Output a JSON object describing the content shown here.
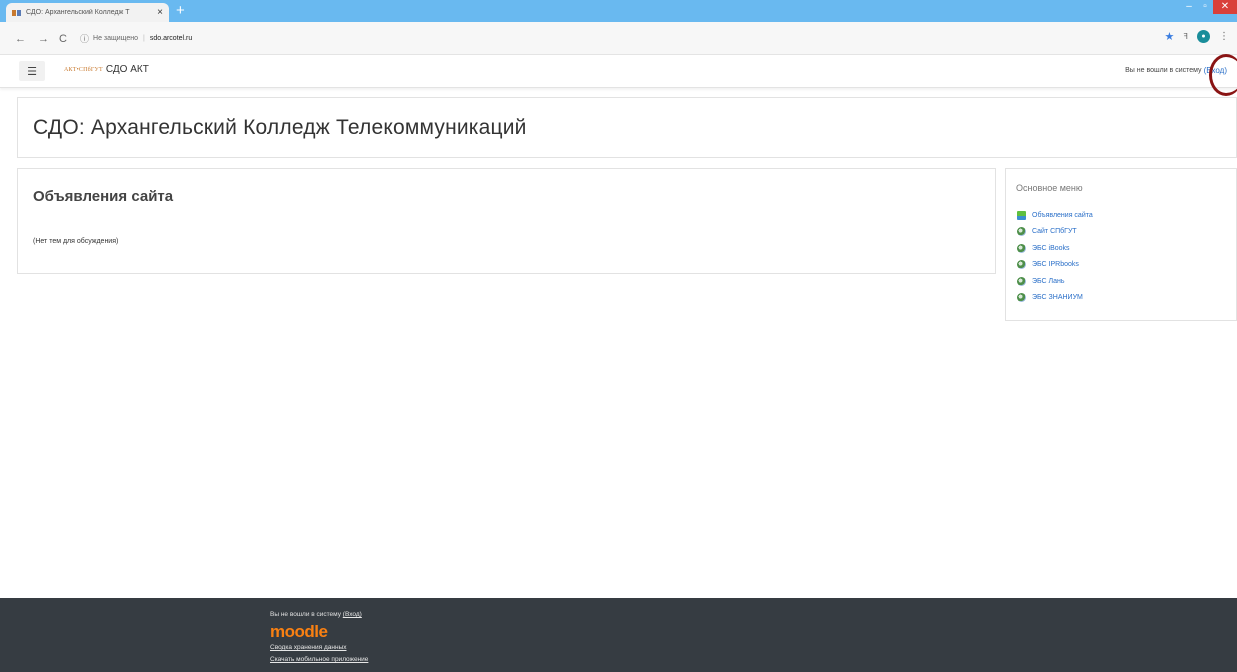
{
  "browser": {
    "tab_title": "СДО: Архангельский Колледж Т",
    "tab_close": "×",
    "new_tab": "+",
    "url_security": "Не защищено",
    "url": "sdo.arcotel.ru",
    "controls": {
      "minimize": "–",
      "maximize": "▫",
      "close": "✕"
    }
  },
  "navbar": {
    "menu_icon": "☰",
    "logo_text": "АКТ•СПбГУТ",
    "site_short_name": "СДО АКТ",
    "login_status": "Вы не вошли в систему",
    "login_link": "(Вход)"
  },
  "header": {
    "title": "СДО: Архангельский Колледж Телекоммуникаций"
  },
  "main": {
    "section_title": "Объявления сайта",
    "empty_message": "(Нет тем для обсуждения)"
  },
  "side_block": {
    "title": "Основное меню",
    "items": [
      {
        "label": "Объявления сайта",
        "icon": "forum-icon"
      },
      {
        "label": "Сайт СПбГУТ",
        "icon": "url-icon"
      },
      {
        "label": "ЭБС iBooks",
        "icon": "url-icon"
      },
      {
        "label": "ЭБС IPRbooks",
        "icon": "url-icon"
      },
      {
        "label": "ЭБС Лань",
        "icon": "url-icon"
      },
      {
        "label": "ЭБС ЗНАНИУМ",
        "icon": "url-icon"
      }
    ]
  },
  "footer": {
    "login_status": "Вы не вошли в систему",
    "login_link": "(Вход)",
    "logo": "moodle",
    "data_retention": "Сводка хранения данных",
    "mobile_app": "Скачать мобильное приложение"
  },
  "colors": {
    "tabbar": "#69b9f0",
    "link": "#2a6fc8",
    "footer_bg": "#363c42",
    "moodle_orange": "#f98012",
    "annotation_circle": "#8a1414"
  }
}
